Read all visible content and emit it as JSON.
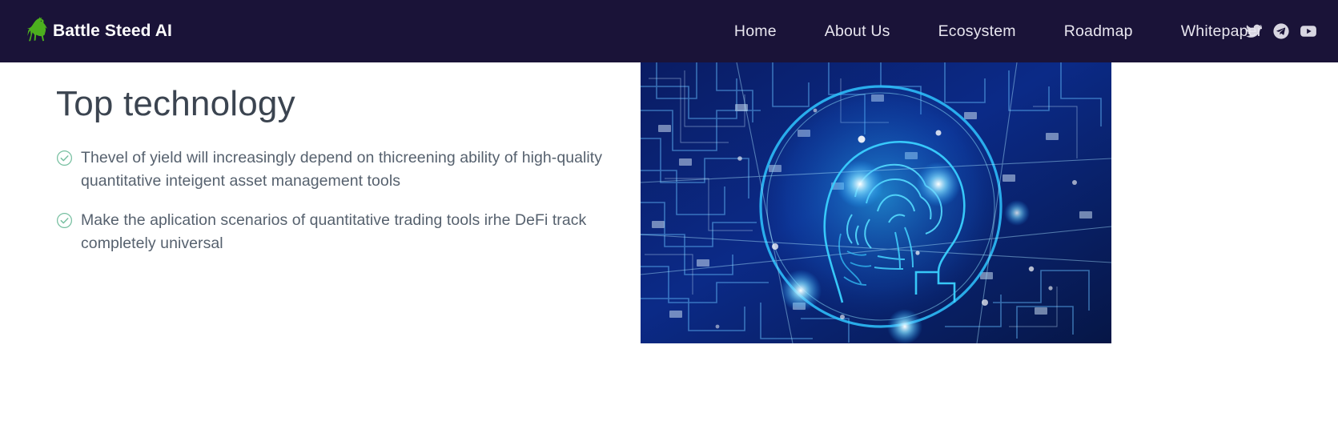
{
  "header": {
    "brand": {
      "name": "Battle Steed AI",
      "logo_icon": "rearing-horse-icon",
      "logo_color": "#4caf1e",
      "text_color": "#ffffff"
    },
    "background_color": "#1a1338",
    "nav": [
      {
        "label": "Home"
      },
      {
        "label": "About Us"
      },
      {
        "label": "Ecosystem"
      },
      {
        "label": "Roadmap"
      },
      {
        "label": "Whitepaper"
      }
    ],
    "social": [
      {
        "icon": "twitter-icon",
        "name": "Twitter"
      },
      {
        "icon": "telegram-icon",
        "name": "Telegram"
      },
      {
        "icon": "youtube-icon",
        "name": "YouTube"
      }
    ]
  },
  "main": {
    "title": "Top technology",
    "title_color": "#3b4450",
    "check_color": "#6fbf9a",
    "features": [
      {
        "text": "Thevel of yield will increasingly depend on thicreening ability of high-quality quantitative inteigent asset management tools"
      },
      {
        "text": "Make the aplication scenarios of quantitative trading tools irhe DeFi track completely universal"
      }
    ],
    "hero_image": {
      "alt": "Glowing blue human head and brain profile over a computer circuit board",
      "accent_color": "#18b6ff",
      "background_color": "#03103c"
    }
  }
}
